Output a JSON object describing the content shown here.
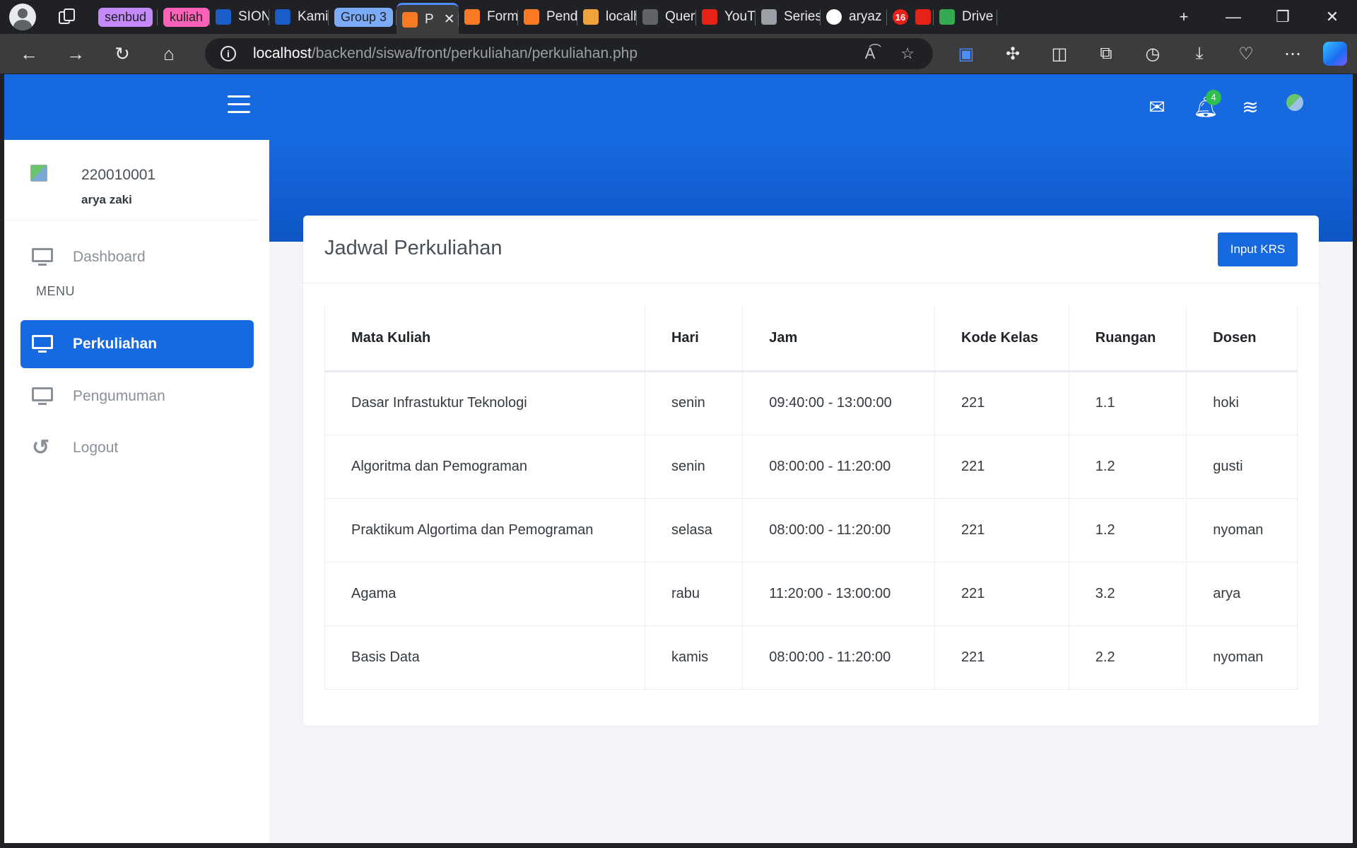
{
  "browser": {
    "tabs": [
      {
        "label": "senbud",
        "kind": "group",
        "color": "#c58af9"
      },
      {
        "label": "kuliah",
        "kind": "group",
        "color": "#ff63b8"
      },
      {
        "label": "SION",
        "kind": "tab",
        "icon": "flame-icon",
        "color": "#1a5cc8"
      },
      {
        "label": "Kamis",
        "kind": "tab",
        "icon": "flame-icon",
        "color": "#1a5cc8"
      },
      {
        "label": "Group 3",
        "kind": "group",
        "color": "#7cacf8"
      },
      {
        "label": "P",
        "kind": "active",
        "icon": "xampp-icon",
        "color": "#fb7a24"
      },
      {
        "label": "Form",
        "kind": "tab",
        "icon": "xampp-icon",
        "color": "#fb7a24"
      },
      {
        "label": "Penda",
        "kind": "tab",
        "icon": "xampp-icon",
        "color": "#fb7a24"
      },
      {
        "label": "localh",
        "kind": "tab",
        "icon": "pma-icon",
        "color": "#f2a23a"
      },
      {
        "label": "Query",
        "kind": "tab",
        "icon": "chatgpt-icon",
        "color": "#5f6368"
      },
      {
        "label": "YouTu",
        "kind": "tab",
        "icon": "youtube-icon",
        "color": "#e62117"
      },
      {
        "label": "Series",
        "kind": "tab",
        "icon": "m-icon",
        "color": "#9aa0a6"
      },
      {
        "label": "aryaz",
        "kind": "tab",
        "icon": "github-icon",
        "color": "#ffffff"
      },
      {
        "label": "(",
        "kind": "tab",
        "icon": "record-icon",
        "color": "#e62117"
      },
      {
        "label": "Drive",
        "kind": "tab",
        "icon": "drive-icon",
        "color": "#34a853"
      }
    ],
    "notification_count_tab": "16",
    "url_host": "localhost",
    "url_path": "/backend/siswa/front/perkuliahan/perkuliahan.php"
  },
  "sidebar": {
    "user_id": "220010001",
    "user_name": "arya zaki",
    "items": [
      {
        "label": "Dashboard",
        "icon": "monitor-icon"
      },
      {
        "label": "Perkuliahan",
        "icon": "monitor-icon"
      },
      {
        "label": "Pengumuman",
        "icon": "monitor-icon"
      },
      {
        "label": "Logout",
        "icon": "undo-icon"
      }
    ],
    "menu_heading": "MENU"
  },
  "topbar": {
    "notification_count": "4"
  },
  "card": {
    "title": "Jadwal Perkuliahan",
    "button_label": "Input KRS"
  },
  "table": {
    "headers": [
      "Mata Kuliah",
      "Hari",
      "Jam",
      "Kode Kelas",
      "Ruangan",
      "Dosen"
    ],
    "rows": [
      [
        "Dasar Infrastuktur Teknologi",
        "senin",
        "09:40:00 - 13:00:00",
        "221",
        "1.1",
        "hoki"
      ],
      [
        "Algoritma dan Pemograman",
        "senin",
        "08:00:00 - 11:20:00",
        "221",
        "1.2",
        "gusti"
      ],
      [
        "Praktikum Algortima dan Pemograman",
        "selasa",
        "08:00:00 - 11:20:00",
        "221",
        "1.2",
        "nyoman"
      ],
      [
        "Agama",
        "rabu",
        "11:20:00 - 13:00:00",
        "221",
        "3.2",
        "arya"
      ],
      [
        "Basis Data",
        "kamis",
        "08:00:00 - 11:20:00",
        "221",
        "2.2",
        "nyoman"
      ]
    ]
  }
}
